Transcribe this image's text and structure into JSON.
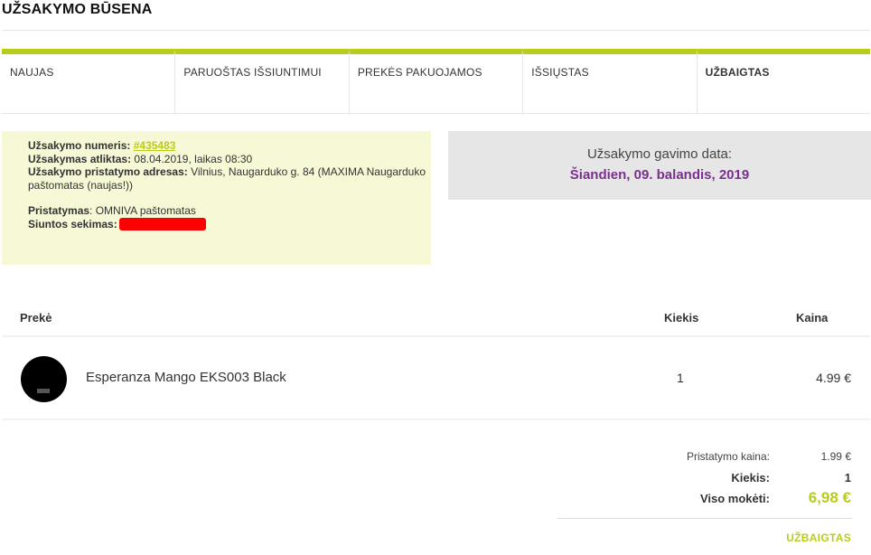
{
  "page": {
    "title": "UŽSAKYMO BŪSENA"
  },
  "steps": [
    {
      "label": "NAUJAS",
      "active": false
    },
    {
      "label": "PARUOŠTAS IŠSIUNTIMUI",
      "active": false
    },
    {
      "label": "PREKĖS PAKUOJAMOS",
      "active": false
    },
    {
      "label": "IŠSIŲSTAS",
      "active": false
    },
    {
      "label": "UŽBAIGTAS",
      "active": true
    }
  ],
  "order": {
    "number_label": "Užsakymo numeris:",
    "number": "#435483",
    "placed_label": "Užsakymas atliktas:",
    "placed_value": "08.04.2019, laikas 08:30",
    "address_label": "Užsakymo pristatymo adresas:",
    "address_value": "Vilnius, Naugarduko g. 84 (MAXIMA Naugarduko paštomatas (naujas!))",
    "delivery_label": "Pristatymas",
    "delivery_value": ": OMNIVA paštomatas",
    "tracking_label": "Siuntos sekimas:"
  },
  "receipt": {
    "label": "Užsakymo gavimo data:",
    "value": "Šiandien, 09. balandis, 2019"
  },
  "table": {
    "headers": {
      "product": "Prekė",
      "qty": "Kiekis",
      "price": "Kaina"
    },
    "items": [
      {
        "name": "Esperanza Mango EKS003 Black",
        "qty": "1",
        "price": "4.99 €"
      }
    ]
  },
  "summary": {
    "shipping_label": "Pristatymo kaina:",
    "shipping_value": "1.99 €",
    "qty_label": "Kiekis:",
    "qty_value": "1",
    "total_label": "Viso mokėti:",
    "total_value": "6,98 €",
    "status": "UŽBAIGTAS"
  },
  "colors": {
    "accent": "#b9cc1c",
    "date": "#7a2f8f",
    "info_bg": "#f6f8d6",
    "date_bg": "#e6e6e6",
    "redaction": "#ff0000"
  }
}
